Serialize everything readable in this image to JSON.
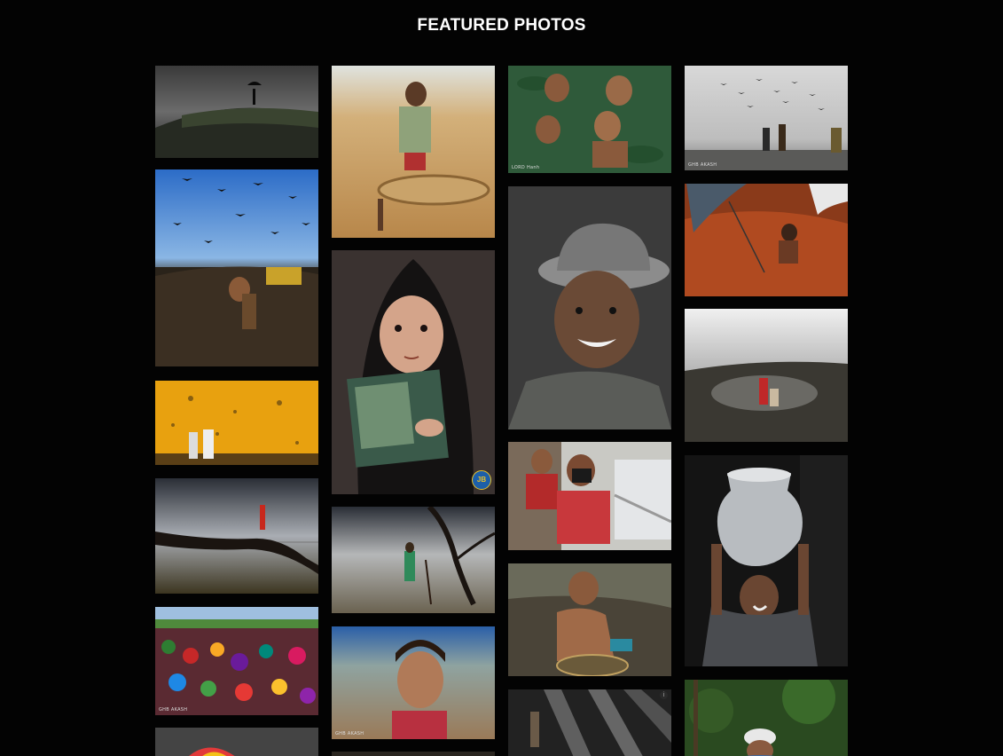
{
  "page": {
    "title": "FEATURED PHOTOS"
  },
  "photos": {
    "p_c3_1": {
      "credit": "LORD Hanh"
    },
    "p_c4_1": {
      "credit": "GHB AKASH"
    },
    "p_c1_5": {
      "credit": "GHB AKASH"
    },
    "p_c2_2": {
      "badge": "JB"
    },
    "p_c2_4": {
      "credit": "GHB AKASH"
    },
    "p_c3_5": {
      "info": "i"
    }
  }
}
